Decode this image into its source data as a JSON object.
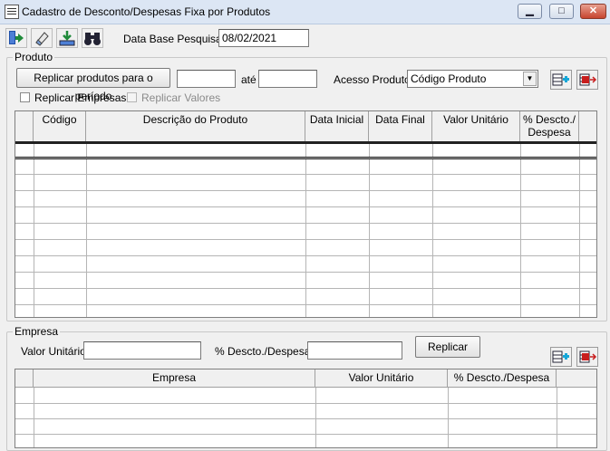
{
  "window": {
    "title": "Cadastro de Desconto/Despesas Fixa por Produtos",
    "minimize": "▁",
    "maximize": "□",
    "close": "✕"
  },
  "toolbar": {
    "buttons": [
      {
        "icon": "exit-door-icon"
      },
      {
        "icon": "eraser-icon"
      },
      {
        "icon": "download-tray-icon"
      },
      {
        "icon": "binoculars-icon"
      }
    ],
    "date_label": "Data Base Pesquisa",
    "date_value": "08/02/2021"
  },
  "produto": {
    "legend": "Produto",
    "replicate_button": "Replicar produtos para o período",
    "date_from": "",
    "until_label": "até",
    "date_to": "",
    "acesso_label": "Acesso Produto",
    "acesso_value": "Código Produto",
    "replicar_empresas": "Replicar Empresas",
    "replicar_valores": "Replicar Valores",
    "columns": [
      "",
      "Código",
      "Descrição do Produto",
      "Data Inicial",
      "Data Final",
      "Valor Unitário",
      "% Descto./ Despesa"
    ]
  },
  "empresa": {
    "legend": "Empresa",
    "valor_label": "Valor Unitário",
    "valor_value": "",
    "descto_label": "% Descto./Despesa",
    "descto_value": "",
    "replicar_button": "Replicar",
    "columns": [
      "",
      "Empresa",
      "Valor Unitário",
      "% Descto./Despesa"
    ]
  }
}
